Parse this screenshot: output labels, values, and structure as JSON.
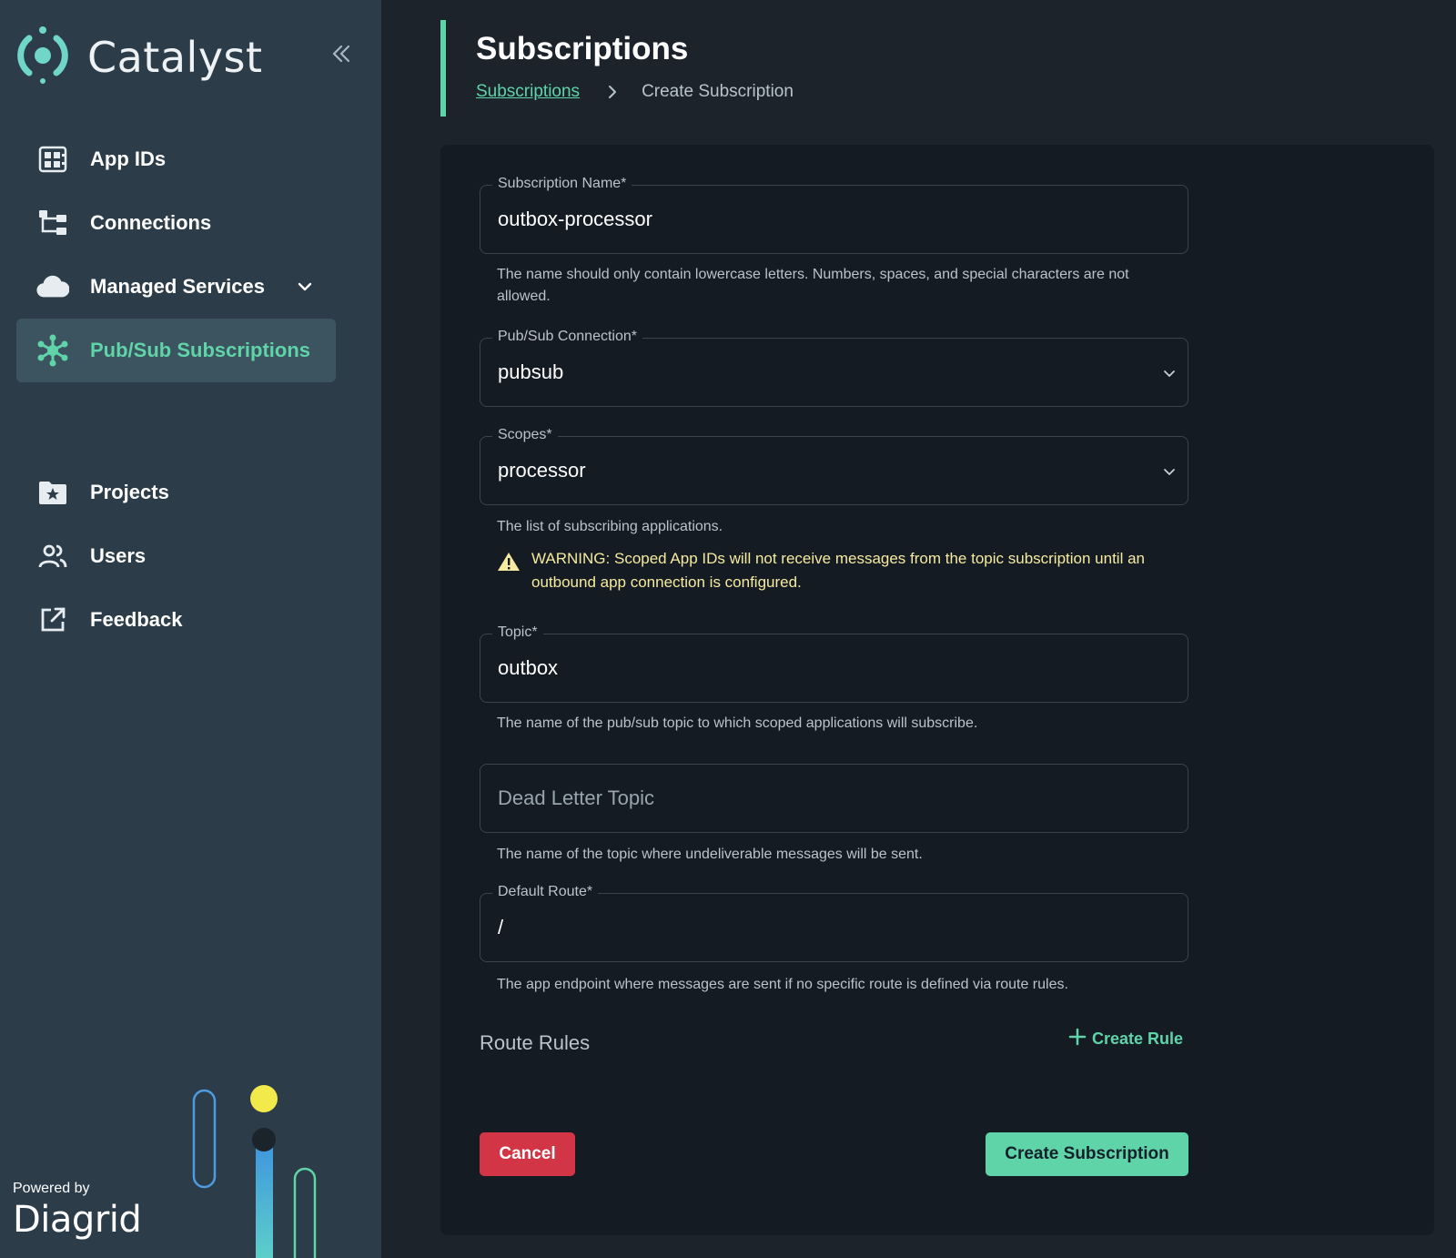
{
  "app": {
    "name": "Catalyst",
    "powered_by": "Powered by",
    "vendor": "Diagrid"
  },
  "sidebar": {
    "items": [
      {
        "label": "App IDs",
        "icon": "app-ids-icon"
      },
      {
        "label": "Connections",
        "icon": "connections-icon"
      },
      {
        "label": "Managed Services",
        "icon": "cloud-icon"
      },
      {
        "label": "Pub/Sub Subscriptions",
        "icon": "pubsub-icon",
        "active": true
      },
      {
        "label": "Projects",
        "icon": "folder-star-icon"
      },
      {
        "label": "Users",
        "icon": "users-icon"
      },
      {
        "label": "Feedback",
        "icon": "external-link-icon"
      }
    ]
  },
  "header": {
    "title": "Subscriptions",
    "breadcrumb": [
      "Subscriptions",
      "Create Subscription"
    ]
  },
  "form": {
    "subscription_name": {
      "label": "Subscription Name",
      "required": "*",
      "value": "outbox-processor",
      "helper": "The name should only contain lowercase letters. Numbers, spaces, and special characters are not allowed."
    },
    "connection": {
      "label": "Pub/Sub Connection",
      "required": "*",
      "value": "pubsub"
    },
    "scopes": {
      "label": "Scopes",
      "required": "*",
      "value": "processor",
      "helper": "The list of subscribing applications.",
      "warning": "WARNING: Scoped App IDs will not receive messages from the topic subscription until an outbound app connection is configured."
    },
    "topic": {
      "label": "Topic",
      "required": "*",
      "value": "outbox",
      "helper": "The name of the pub/sub topic to which scoped applications will subscribe."
    },
    "dead_letter": {
      "placeholder": "Dead Letter Topic",
      "helper": "The name of the topic where undeliverable messages will be sent."
    },
    "default_route": {
      "label": "Default Route",
      "required": "*",
      "value": "/",
      "helper": "The app endpoint where messages are sent if no specific route is defined via route rules."
    },
    "route_rules": {
      "title": "Route Rules",
      "create_label": "Create Rule"
    },
    "cancel_label": "Cancel",
    "submit_label": "Create Subscription"
  },
  "colors": {
    "accent": "#5fd4a8",
    "danger": "#d23545",
    "sidebar_bg": "#2c3c48",
    "page_bg": "#1c232b",
    "card_bg": "#151b22",
    "warning_text": "#f6eaa0"
  }
}
